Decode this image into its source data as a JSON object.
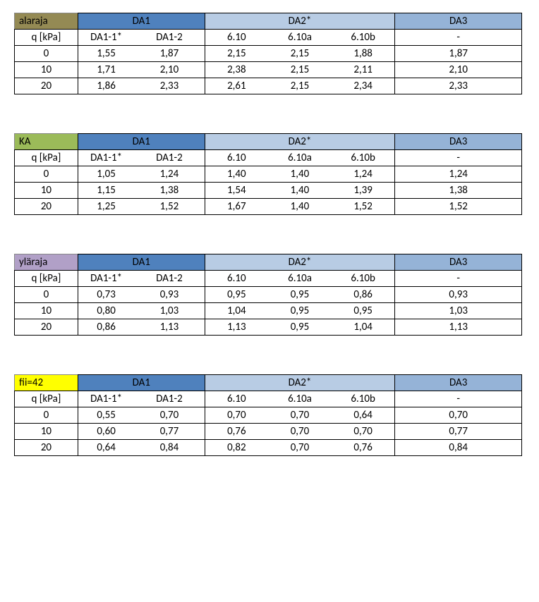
{
  "labels": {
    "qkpa": "q [kPa]",
    "da1": "DA1",
    "da2": "DA2*",
    "da3": "DA3",
    "da1_1": "DA1-1*",
    "da1_2": "DA1-2",
    "s610": "6.10",
    "s610a": "6.10a",
    "s610b": "6.10b",
    "dash": "-"
  },
  "tables": [
    {
      "corner_label": "alaraja",
      "corner_class": "corner-olive",
      "rows": [
        {
          "q": "0",
          "d11": "1,55",
          "d12": "1,87",
          "s610": "2,15",
          "s610a": "2,15",
          "s610b": "1,88",
          "da3": "1,87"
        },
        {
          "q": "10",
          "d11": "1,71",
          "d12": "2,10",
          "s610": "2,38",
          "s610a": "2,15",
          "s610b": "2,11",
          "da3": "2,10"
        },
        {
          "q": "20",
          "d11": "1,86",
          "d12": "2,33",
          "s610": "2,61",
          "s610a": "2,15",
          "s610b": "2,34",
          "da3": "2,33"
        }
      ]
    },
    {
      "corner_label": "KA",
      "corner_class": "corner-green",
      "rows": [
        {
          "q": "0",
          "d11": "1,05",
          "d12": "1,24",
          "s610": "1,40",
          "s610a": "1,40",
          "s610b": "1,24",
          "da3": "1,24"
        },
        {
          "q": "10",
          "d11": "1,15",
          "d12": "1,38",
          "s610": "1,54",
          "s610a": "1,40",
          "s610b": "1,39",
          "da3": "1,38"
        },
        {
          "q": "20",
          "d11": "1,25",
          "d12": "1,52",
          "s610": "1,67",
          "s610a": "1,40",
          "s610b": "1,52",
          "da3": "1,52"
        }
      ]
    },
    {
      "corner_label": "yläraja",
      "corner_class": "corner-purple",
      "rows": [
        {
          "q": "0",
          "d11": "0,73",
          "d12": "0,93",
          "s610": "0,95",
          "s610a": "0,95",
          "s610b": "0,86",
          "da3": "0,93"
        },
        {
          "q": "10",
          "d11": "0,80",
          "d12": "1,03",
          "s610": "1,04",
          "s610a": "0,95",
          "s610b": "0,95",
          "da3": "1,03"
        },
        {
          "q": "20",
          "d11": "0,86",
          "d12": "1,13",
          "s610": "1,13",
          "s610a": "0,95",
          "s610b": "1,04",
          "da3": "1,13"
        }
      ]
    },
    {
      "corner_label": "fii=42",
      "corner_class": "corner-yellow",
      "rows": [
        {
          "q": "0",
          "d11": "0,55",
          "d12": "0,70",
          "s610": "0,70",
          "s610a": "0,70",
          "s610b": "0,64",
          "da3": "0,70"
        },
        {
          "q": "10",
          "d11": "0,60",
          "d12": "0,77",
          "s610": "0,76",
          "s610a": "0,70",
          "s610b": "0,70",
          "da3": "0,77"
        },
        {
          "q": "20",
          "d11": "0,64",
          "d12": "0,84",
          "s610": "0,82",
          "s610a": "0,70",
          "s610b": "0,76",
          "da3": "0,84"
        }
      ]
    }
  ]
}
